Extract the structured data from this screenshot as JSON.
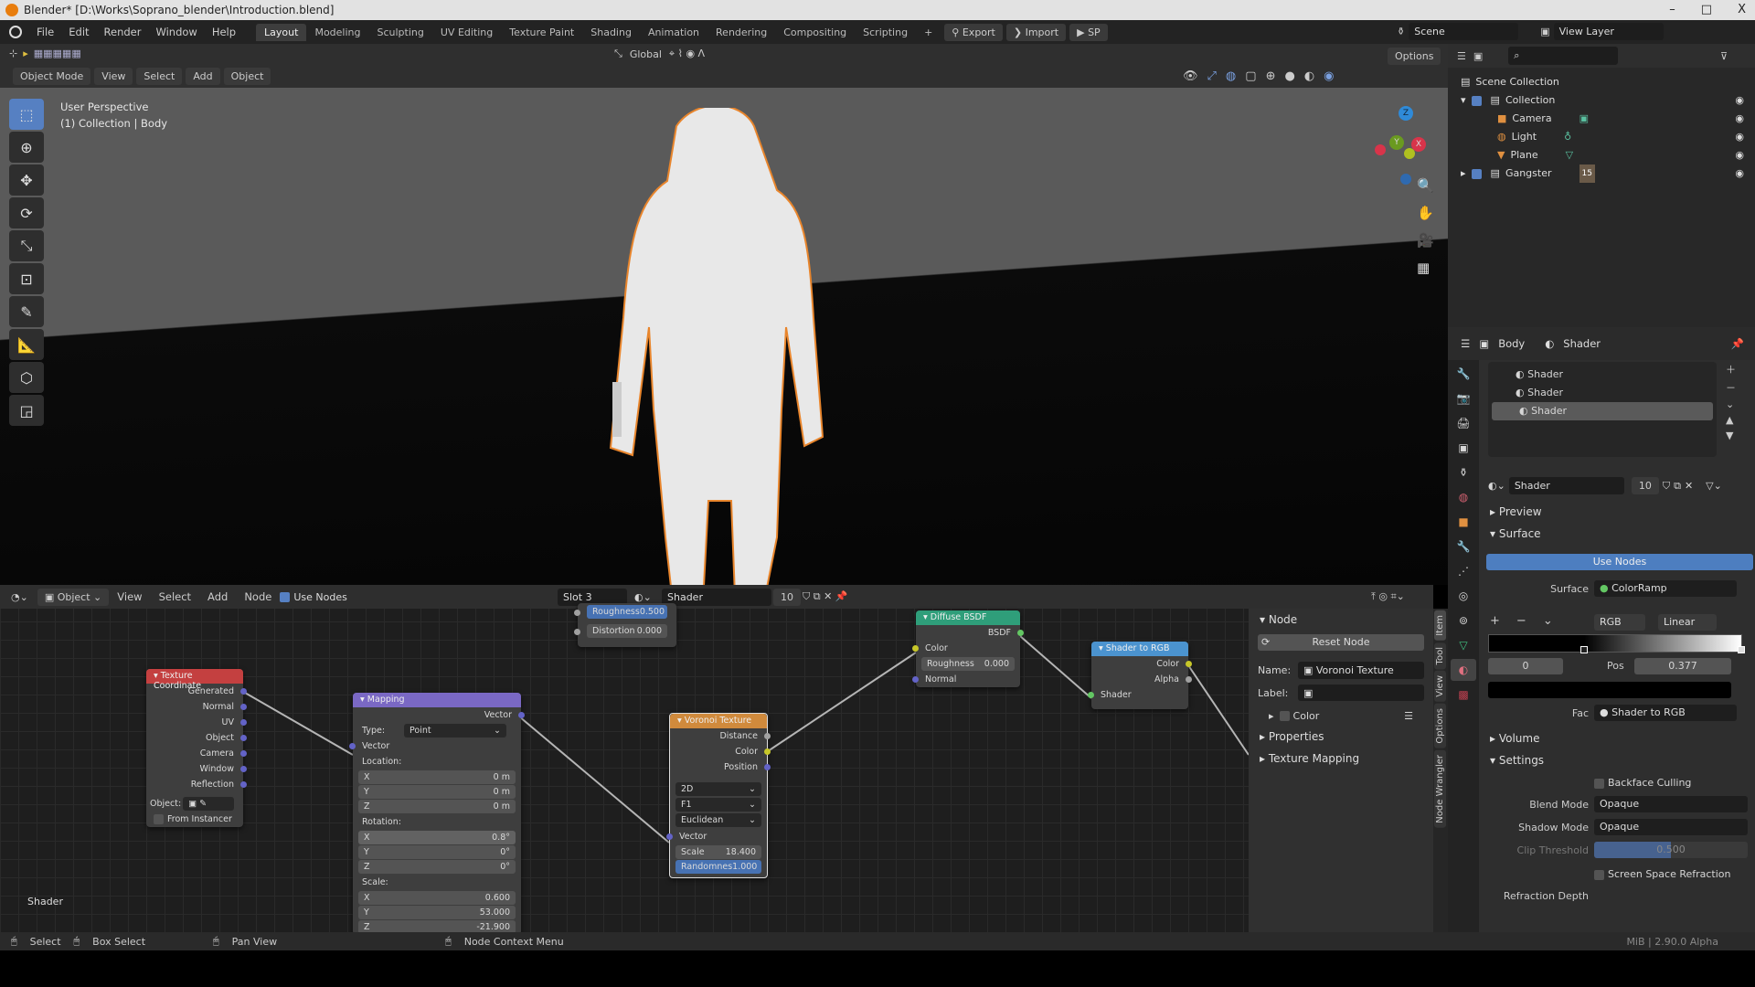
{
  "window": {
    "title": "Blender* [D:\\Works\\Soprano_blender\\Introduction.blend]",
    "minimize": "–",
    "maximize": "□",
    "close": "X"
  },
  "menubar": {
    "items": [
      "File",
      "Edit",
      "Render",
      "Window",
      "Help"
    ]
  },
  "workspaces": {
    "tabs": [
      "Layout",
      "Modeling",
      "Sculpting",
      "UV Editing",
      "Texture Paint",
      "Shading",
      "Animation",
      "Rendering",
      "Compositing",
      "Scripting"
    ],
    "active": "Layout",
    "add": "+"
  },
  "addons": {
    "export": "Export",
    "import": "Import",
    "sp": "SP"
  },
  "scene": {
    "name": "Scene",
    "view_layer": "View Layer"
  },
  "viewport": {
    "mode": "Object Mode",
    "menus": [
      "View",
      "Select",
      "Add",
      "Object"
    ],
    "orientation": "Global",
    "options": "Options",
    "overlay_line1": "User Perspective",
    "overlay_line2": "(1) Collection | Body",
    "gizmo": {
      "x": "X",
      "y": "Y",
      "z": "Z"
    }
  },
  "outliner": {
    "root": "Scene Collection",
    "items": [
      {
        "name": "Collection",
        "level": 0
      },
      {
        "name": "Camera",
        "level": 1
      },
      {
        "name": "Light",
        "level": 1
      },
      {
        "name": "Plane",
        "level": 1
      },
      {
        "name": "Gangster",
        "level": 0,
        "badge": "15"
      }
    ]
  },
  "properties": {
    "header": {
      "object": "Body",
      "material": "Shader"
    },
    "slots": [
      "Shader",
      "Shader",
      "Shader"
    ],
    "selected_slot": 2,
    "material_name": "Shader",
    "users": "10",
    "panels": {
      "preview": "Preview",
      "surface": "Surface",
      "volume": "Volume",
      "settings": "Settings"
    },
    "use_nodes": "Use Nodes",
    "surface_label": "Surface",
    "surface_value": "ColorRamp",
    "ramp": {
      "color_mode": "RGB",
      "interpolation": "Linear",
      "index": "0",
      "pos_label": "Pos",
      "pos_value": "0.377",
      "fac_label": "Fac",
      "fac_value": "Shader to RGB"
    },
    "settings": {
      "backface_culling": "Backface Culling",
      "blend_mode_label": "Blend Mode",
      "blend_mode": "Opaque",
      "shadow_mode_label": "Shadow Mode",
      "shadow_mode": "Opaque",
      "clip_threshold_label": "Clip Threshold",
      "clip_threshold": "0.500",
      "ssr": "Screen Space Refraction",
      "refraction_depth_label": "Refraction Depth"
    }
  },
  "node_editor": {
    "type": "Object",
    "menus": [
      "View",
      "Select",
      "Add",
      "Node"
    ],
    "use_nodes": "Use Nodes",
    "slot": "Slot 3",
    "material": "Shader",
    "users": "10",
    "tree_label": "Shader",
    "nodes": {
      "partial": {
        "roughness_label": "Roughness",
        "roughness": "0.500",
        "distortion_label": "Distortion",
        "distortion": "0.000"
      },
      "texcoord": {
        "title": "Texture Coordinate",
        "outputs": [
          "Generated",
          "Normal",
          "UV",
          "Object",
          "Camera",
          "Window",
          "Reflection"
        ],
        "object_label": "Object:",
        "from_instancer": "From Instancer"
      },
      "mapping": {
        "title": "Mapping",
        "out": "Vector",
        "type_label": "Type:",
        "type": "Point",
        "in": "Vector",
        "location": "Location:",
        "loc": [
          [
            "X",
            "0 m"
          ],
          [
            "Y",
            "0 m"
          ],
          [
            "Z",
            "0 m"
          ]
        ],
        "rotation": "Rotation:",
        "rot": [
          [
            "X",
            "0.8°"
          ],
          [
            "Y",
            "0°"
          ],
          [
            "Z",
            "0°"
          ]
        ],
        "scale": "Scale:",
        "scl": [
          [
            "X",
            "0.600"
          ],
          [
            "Y",
            "53.000"
          ],
          [
            "Z",
            "-21.900"
          ]
        ]
      },
      "voronoi": {
        "title": "Voronoi Texture",
        "outputs": [
          "Distance",
          "Color",
          "Position"
        ],
        "dim": "2D",
        "feature": "F1",
        "metric": "Euclidean",
        "in": "Vector",
        "scale_label": "Scale",
        "scale": "18.400",
        "rand_label": "Randomnes",
        "rand": "1.000"
      },
      "diffuse": {
        "title": "Diffuse BSDF",
        "out": "BSDF",
        "color": "Color",
        "roughness_label": "Roughness",
        "roughness": "0.000",
        "normal": "Normal"
      },
      "shader_rgb": {
        "title": "Shader to RGB",
        "outputs": [
          "Color",
          "Alpha"
        ],
        "in": "Shader"
      }
    },
    "sidebar": {
      "panel": "Node",
      "reset": "Reset Node",
      "name_label": "Name:",
      "name": "Voronoi Texture",
      "label_label": "Label:",
      "color": "Color",
      "properties": "Properties",
      "texture_mapping": "Texture Mapping",
      "tabs": [
        "Item",
        "Tool",
        "View",
        "Options",
        "Node Wrangler"
      ]
    }
  },
  "statusbar": {
    "select": "Select",
    "box_select": "Box Select",
    "pan_view": "Pan View",
    "context_menu": "Node Context Menu",
    "version": "MiB | 2.90.0 Alpha"
  },
  "colors": {
    "accent": "#5680c2",
    "texcoord": "#c44040",
    "mapping": "#7a68c4",
    "voronoi": "#d08a3c",
    "diffuse": "#2f9e7a",
    "shader_rgb": "#4b93cf",
    "selection": "#e8852c"
  }
}
